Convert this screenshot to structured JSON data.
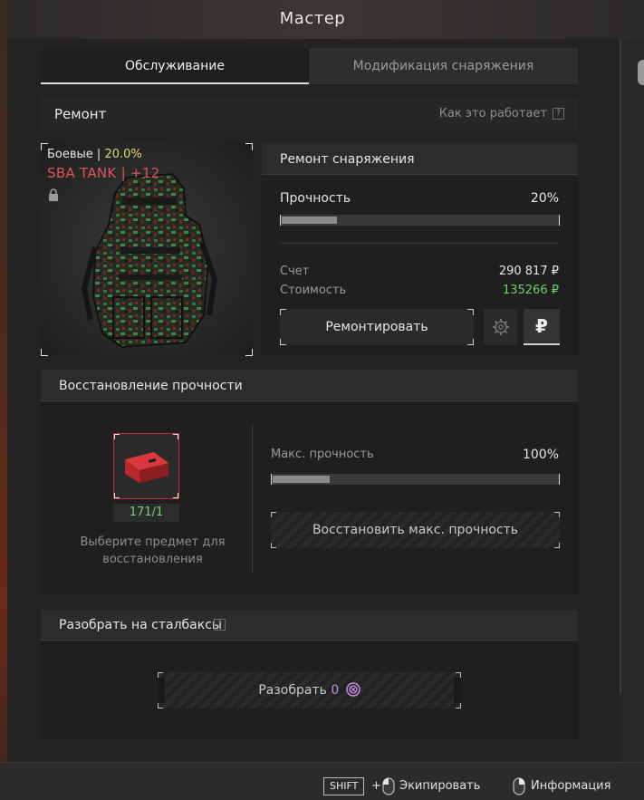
{
  "title": "Мастер",
  "tabs": [
    {
      "label": "Обслуживание"
    },
    {
      "label": "Модификация снаряжения"
    }
  ],
  "repair": {
    "title": "Ремонт",
    "how_it_works": "Как это работает",
    "help": "?"
  },
  "item": {
    "category": "Боевые |",
    "percent": "20.0%",
    "name": "SBA TANK | +12",
    "icon": "backpack-camo-image",
    "locked": true
  },
  "repair_equipment": {
    "title": "Ремонт снаряжения",
    "durability_label": "Прочность",
    "durability_value": "20%",
    "durability_fraction": 0.2,
    "account_label": "Счет",
    "account_value": "290 817 ₽",
    "cost_label": "Стоимость",
    "cost_value": "135266 ₽",
    "repair_button": "Ремонтировать",
    "currency_button": "₽"
  },
  "restore": {
    "title": "Восстановление прочности",
    "slot_count": "171/1",
    "hint": "Выберите предмет для восстановления",
    "max_durability_label": "Макс. прочность",
    "max_durability_value": "100%",
    "max_durability_fraction": 0.2,
    "restore_button": "Восстановить макс. прочность"
  },
  "disassemble": {
    "title": "Разобрать на сталбаксы",
    "help": "?",
    "button_label": "Разобрать",
    "button_amount": "0"
  },
  "footer": {
    "shift_key": "SHIFT",
    "plus": "+",
    "equip_label": "Экипировать",
    "info_label": "Информация"
  },
  "colors": {
    "accent_yellow": "#e8d86a",
    "item_name_red": "#e0555a",
    "cost_green": "#6dd16a",
    "coin_purple": "#c58ce6"
  }
}
